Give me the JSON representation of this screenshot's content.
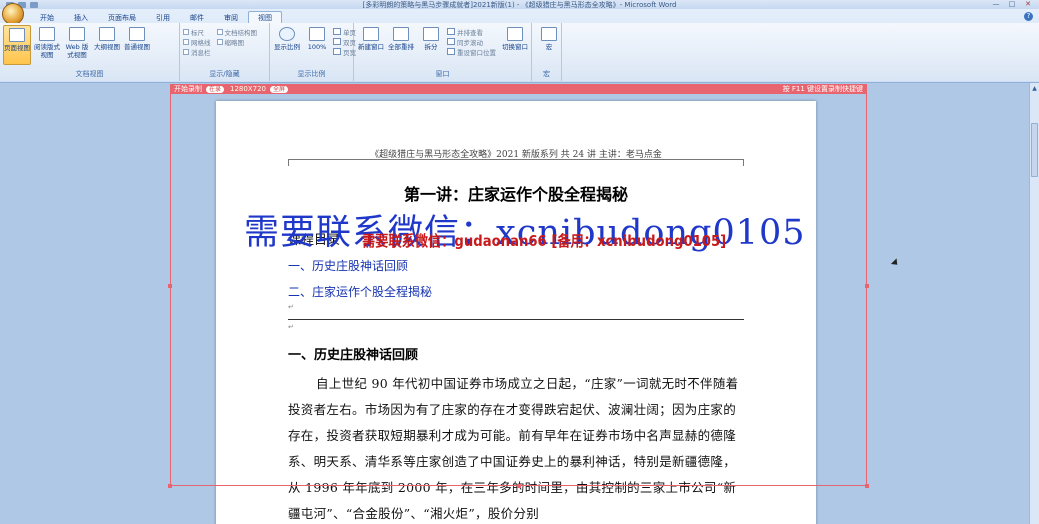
{
  "window": {
    "title": "[多彩明朗的策略与黑马步骤成就者]2021新版(1) - 《超级猎庄与黑马形态全攻略》- Microsoft Word",
    "controls": [
      "—",
      "□",
      "✕"
    ]
  },
  "ribbon": {
    "tabs": [
      "开始",
      "插入",
      "页面布局",
      "引用",
      "邮件",
      "审阅",
      "视图"
    ],
    "active_tab": "视图",
    "groups": {
      "doc_views": {
        "label": "文档视图",
        "buttons": [
          "页面视图",
          "阅读版式视图",
          "Web 版式视图",
          "大纲视图",
          "普通视图"
        ]
      },
      "show_hide": {
        "label": "显示/隐藏",
        "items": [
          "标尺",
          "网格线",
          "消息栏",
          "文档结构图",
          "缩略图"
        ]
      },
      "zoom": {
        "label": "显示比例",
        "buttons": [
          "显示比例",
          "100%"
        ],
        "items": [
          "单页",
          "双页",
          "页宽"
        ]
      },
      "window": {
        "label": "窗口",
        "buttons": [
          "新建窗口",
          "全部重排",
          "拆分"
        ],
        "items": [
          "并排查看",
          "同步滚动",
          "重设窗口位置"
        ],
        "switch_label": "切换窗口"
      },
      "macro": {
        "label": "宏",
        "button": "宏"
      }
    }
  },
  "recorder": {
    "label": "开始录制",
    "pill": "在录",
    "size": "1280X720",
    "extra": "全屏",
    "hint": "按 F11 键设置录制快捷键"
  },
  "document": {
    "header": "《超级猎庄与黑马形态全攻略》2021 新版系列 共 24 讲  主讲：老马点金",
    "title": "第一讲：庄家运作个股全程揭秘",
    "toc_heading": "课程目录",
    "toc": [
      "一、历史庄股神话回顾",
      "二、庄家运作个股全程揭秘"
    ],
    "section_title": "一、历史庄股神话回顾",
    "paragraph": "自上世纪 90 年代初中国证券市场成立之日起，“庄家”一词就无时不伴随着投资者左右。市场因为有了庄家的存在才变得跌宕起伏、波澜壮阔；因为庄家的存在，投资者获取短期暴利才成为可能。前有早年在证券市场中名声显赫的德隆系、明天系、清华系等庄家创造了中国证券史上的暴利神话，特别是新疆德隆，从 1996 年年底到 2000 年，在三年多的时间里，由其控制的三家上市公司“新疆屯河”、“合金股份”、“湘火炬”，股价分别"
  },
  "watermarks": {
    "blue": "需要联系微信：xcnibudong0105",
    "red": "需要联系微信：gudaonan66 [备用：xcnibudong0105]"
  }
}
